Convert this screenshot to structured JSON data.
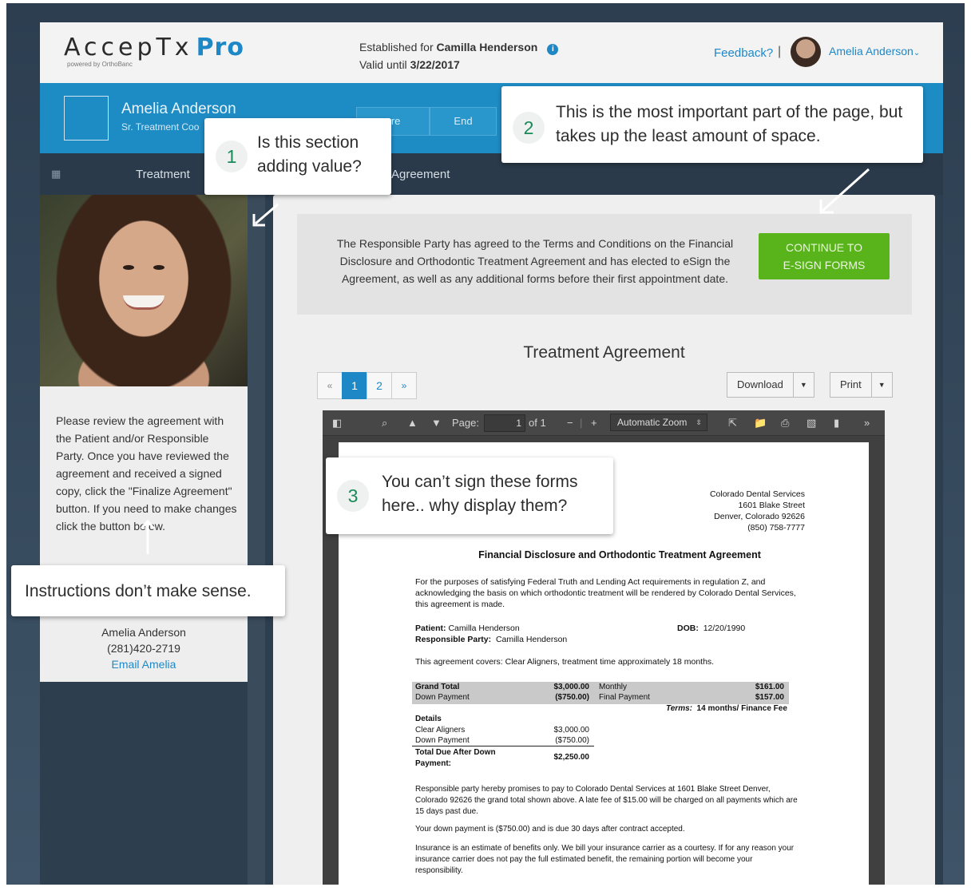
{
  "header": {
    "logo_main": "AccepTx",
    "logo_pro": "Pro",
    "logo_sub": "powered by OrthoBanc",
    "established_prefix": "Established for ",
    "established_name": "Camilla Henderson",
    "valid_prefix": "Valid until ",
    "valid_date": "3/22/2017",
    "feedback": "Feedback?",
    "separator": "|",
    "user_name": "Amelia Anderson"
  },
  "band": {
    "name": "Amelia Anderson",
    "role": "Sr. Treatment Coo",
    "btn_share": "are",
    "btn_end": "End"
  },
  "tabs": {
    "treatment": "Treatment",
    "agreement": "Agreement"
  },
  "left": {
    "instructions": "Please review the agreement with the Patient and/or Responsible Party. Once you have reviewed the agreement and received a signed copy, click the \"Finalize Agreement\" button. If you need to make changes click the button below.",
    "contact_name": "Amelia Anderson",
    "contact_phone": "(281)420-2719",
    "contact_email": "Email Amelia"
  },
  "notice": {
    "text": "The Responsible Party has agreed to the Terms and Conditions on the Financial Disclosure and Orthodontic Treatment Agreement and has elected to eSign the Agreement, as well as any additional forms before their first appointment date.",
    "cta_line1": "CONTINUE TO",
    "cta_line2": "E-SIGN FORMS"
  },
  "doc": {
    "title": "Treatment Agreement",
    "pager": [
      "«",
      "1",
      "2",
      "»"
    ],
    "download": "Download",
    "print": "Print"
  },
  "viewer": {
    "page_label": "Page:",
    "page_value": "1",
    "page_of": "of 1",
    "zoom": "Automatic Zoom"
  },
  "pdf": {
    "addr1": "Colorado Dental Services",
    "addr2": "1601 Blake Street",
    "addr3": "Denver, Colorado 92626",
    "addr4": "(850) 758-7777",
    "heading": "Financial Disclosure and Orthodontic Treatment Agreement",
    "intro": "For the purposes of satisfying Federal Truth and Lending Act requirements in regulation Z, and acknowledging the basis on which orthodontic treatment will be rendered by Colorado Dental Services, this agreement is made.",
    "patient_label": "Patient:",
    "patient": "Camilla Henderson",
    "dob_label": "DOB:",
    "dob": "12/20/1990",
    "resp_label": "Responsible Party:",
    "resp": "Camilla Henderson",
    "covers": "This agreement covers: Clear Aligners, treatment time approximately 18 months.",
    "grand_total_label": "Grand Total",
    "grand_total": "$3,000.00",
    "down_label": "Down Payment",
    "down": "($750.00)",
    "monthly_label": "Monthly",
    "monthly": "$161.00",
    "final_label": "Final Payment",
    "final": "$157.00",
    "terms_label": "Terms:",
    "terms": "14 months/  Finance Fee",
    "details_label": "Details",
    "clear_label": "Clear Aligners",
    "clear": "$3,000.00",
    "down2_label": "Down Payment",
    "down2": "($750.00)",
    "due_label": "Total Due After Down Payment:",
    "due": "$2,250.00",
    "para1": "Responsible party hereby promises to pay to Colorado Dental Services at 1601 Blake Street Denver, Colorado 92626 the grand total shown above.  A late fee of $15.00 will be charged on all payments which are 15 days past due.",
    "para2": "Your down payment is ($750.00) and is due 30 days after contract accepted.",
    "para3": "Insurance is an estimate of benefits only.  We bill your insurance carrier as a courtesy.  If for any reason your insurance carrier does not pay the full estimated benefit, the remaining portion will become your responsibility."
  },
  "annotations": {
    "n1": "1",
    "c1": "Is this section adding value?",
    "n2": "2",
    "c2": "This is the most important part of the page, but takes up the least amount of space.",
    "n3": "3",
    "c3": "You can’t sign these forms here.. why display them?",
    "c4": "Instructions don’t make sense."
  },
  "colors": {
    "brand_blue": "#1e88c7",
    "cta_green": "#59b31a",
    "dark_bg": "#2d3e4f"
  }
}
